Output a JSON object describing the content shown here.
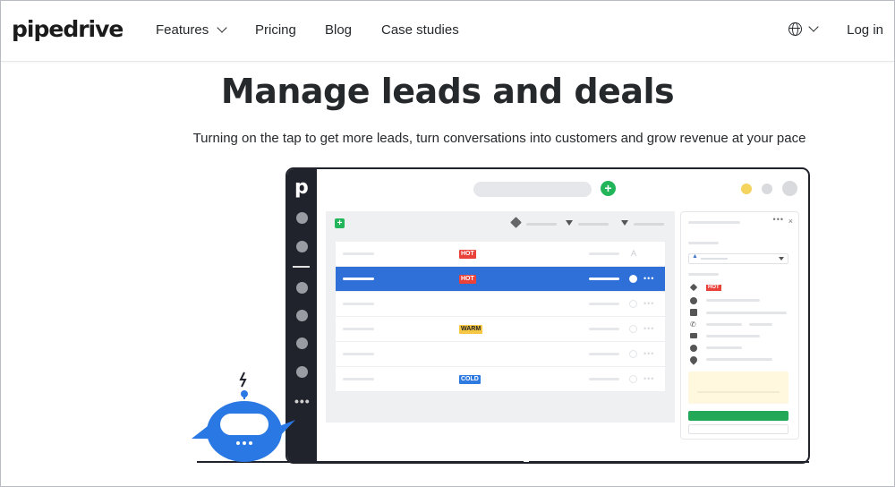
{
  "nav": {
    "logo": "pipedrive",
    "features": "Features",
    "pricing": "Pricing",
    "blog": "Blog",
    "case_studies": "Case studies",
    "login": "Log in"
  },
  "hero": {
    "title": "Manage leads and deals",
    "subtitle": "Turning on the tap to get more leads, turn conversations into customers and grow revenue at your pace"
  },
  "mockup": {
    "sidebar_logo": "p",
    "sidebar_more": "•••",
    "add_symbol": "+",
    "rows": [
      {
        "badge": "HOT",
        "badge_type": "hot",
        "selected": false
      },
      {
        "badge": "HOT",
        "badge_type": "hot",
        "selected": true
      },
      {
        "badge": "",
        "badge_type": "",
        "selected": false
      },
      {
        "badge": "WARM",
        "badge_type": "warm",
        "selected": false
      },
      {
        "badge": "",
        "badge_type": "",
        "selected": false
      },
      {
        "badge": "COLD",
        "badge_type": "cold",
        "selected": false
      }
    ],
    "detail": {
      "hot_badge": "HOT",
      "more": "•••",
      "close": "×"
    }
  },
  "colors": {
    "brand_green": "#22b55a",
    "selected_blue": "#2f6fd8",
    "hot": "#e8423b",
    "warm": "#f6c744",
    "cold": "#2f7ae0",
    "robot_blue": "#2a78e4"
  },
  "icons": [
    "chevron-down-icon",
    "globe-icon",
    "plus-icon",
    "tag-icon",
    "person-icon",
    "phone-icon",
    "mail-icon",
    "location-icon",
    "lightning-icon"
  ]
}
